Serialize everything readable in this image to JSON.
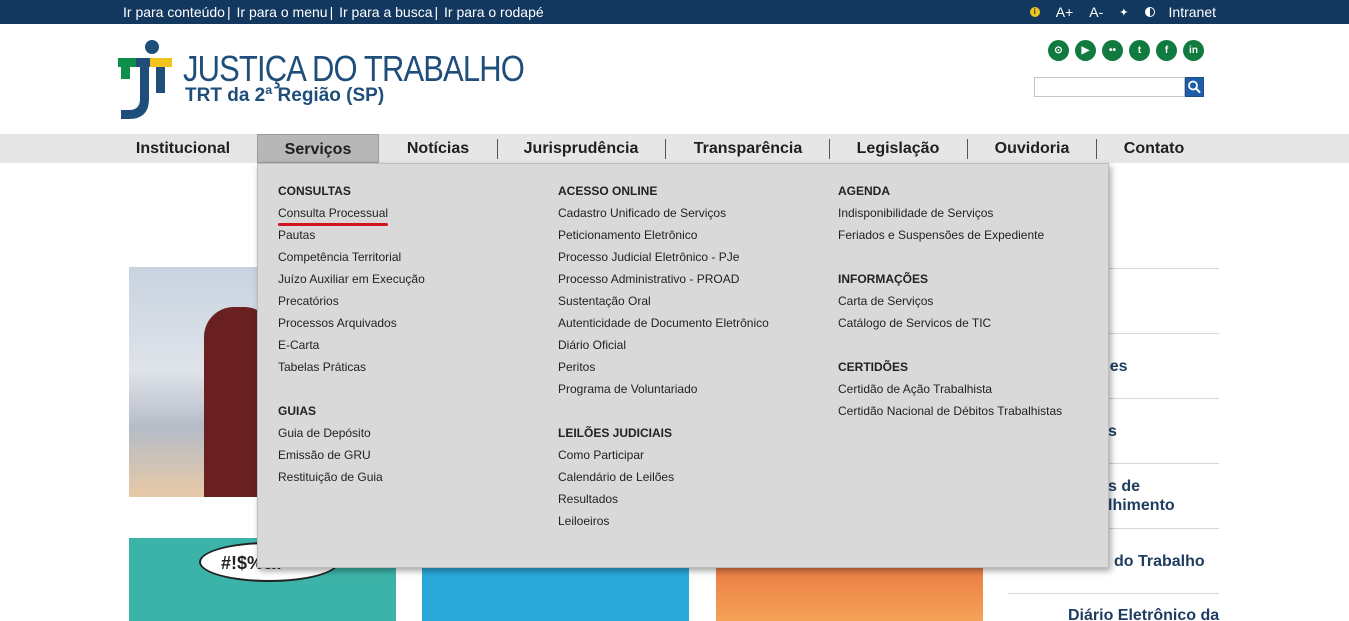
{
  "topbar": {
    "skip_links": [
      "Ir para conteúdo",
      "Ir para o menu",
      "Ir para a busca",
      "Ir para o rodapé"
    ],
    "font_increase": "A+",
    "font_decrease": "A-",
    "intranet": "Intranet",
    "colors": {
      "background": "#12385f",
      "text": "#ffffff"
    }
  },
  "header": {
    "logo_title": "JUSTIÇA DO TRABALHO",
    "logo_subtitle": "TRT da 2ª Região (SP)",
    "social_icons": [
      "rss-icon",
      "youtube-icon",
      "flickr-icon",
      "twitter-icon",
      "facebook-icon",
      "linkedin-icon"
    ],
    "social_color": "#117a3e",
    "search": {
      "value": "",
      "placeholder": ""
    }
  },
  "nav": {
    "items": [
      {
        "label": "Institucional",
        "active": false
      },
      {
        "label": "Serviços",
        "active": true
      },
      {
        "label": "Notícias",
        "active": false
      },
      {
        "label": "Jurisprudência",
        "active": false
      },
      {
        "label": "Transparência",
        "active": false
      },
      {
        "label": "Legislação",
        "active": false
      },
      {
        "label": "Ouvidoria",
        "active": false
      },
      {
        "label": "Contato",
        "active": false
      }
    ]
  },
  "dropdown": {
    "col1": {
      "sections": [
        {
          "title": "CONSULTAS",
          "links": [
            "Consulta Processual",
            "Pautas",
            "Competência Territorial",
            "Juízo Auxiliar em Execução",
            "Precatórios",
            "Processos Arquivados",
            "E-Carta",
            "Tabelas Práticas"
          ]
        },
        {
          "title": "GUIAS",
          "links": [
            "Guia de Depósito",
            "Emissão de GRU",
            "Restituição de Guia"
          ]
        }
      ]
    },
    "col2": {
      "sections": [
        {
          "title": "ACESSO ONLINE",
          "links": [
            "Cadastro Unificado de Serviços",
            "Peticionamento Eletrônico",
            "Processo Judicial Eletrônico - PJe",
            "Processo Administrativo - PROAD",
            "Sustentação Oral",
            "Autenticidade de Documento Eletrônico",
            "Diário Oficial",
            "Peritos",
            "Programa de Voluntariado"
          ]
        },
        {
          "title": "LEILÕES JUDICIAIS",
          "links": [
            "Como Participar",
            "Calendário de Leilões",
            "Resultados",
            "Leiloeiros"
          ]
        }
      ]
    },
    "col3": {
      "sections": [
        {
          "title": "AGENDA",
          "links": [
            "Indisponibilidade de Serviços",
            "Feriados e Suspensões de Expediente"
          ]
        },
        {
          "title": "INFORMAÇÕES",
          "links": [
            "Carta de Serviços",
            "Catálogo de Servicos de TIC"
          ]
        },
        {
          "title": "CERTIDÕES",
          "links": [
            "Certidão de Ação Trabalhista",
            "Certidão Nacional de Débitos Trabalhistas"
          ]
        }
      ]
    },
    "highlight_color": "#d0151e"
  },
  "background": {
    "bubble_text": "#!$%&!",
    "sidebar_labels": [
      "ões",
      "s",
      "s de",
      "lhimento",
      "do Trabalho",
      "Diário Eletrônico da"
    ]
  }
}
